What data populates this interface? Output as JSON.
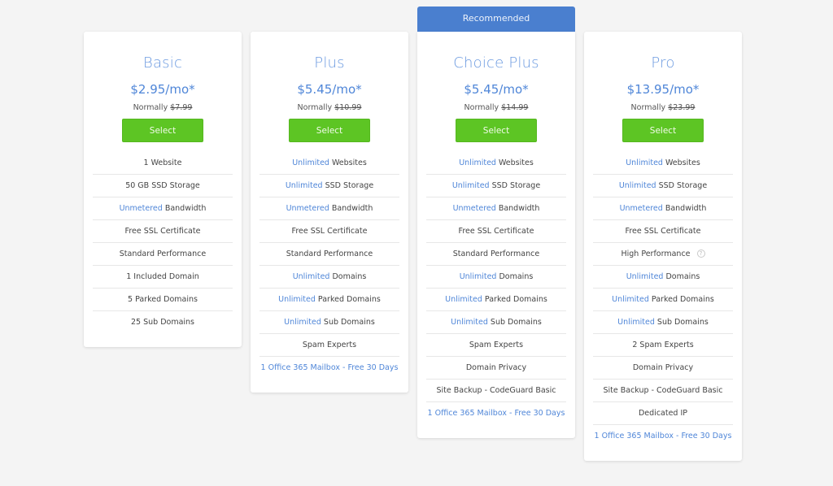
{
  "recommended_label": "Recommended",
  "plans": [
    {
      "name": "Basic",
      "price": "$2.95/mo*",
      "normally_label": "Normally",
      "normal_price": "$7.99",
      "select_label": "Select",
      "features": [
        {
          "highlight": "",
          "text": "1 Website"
        },
        {
          "highlight": "",
          "text": "50 GB SSD Storage"
        },
        {
          "highlight": "Unmetered",
          "text": " Bandwidth"
        },
        {
          "highlight": "",
          "text": "Free SSL Certificate"
        },
        {
          "highlight": "",
          "text": "Standard Performance"
        },
        {
          "highlight": "",
          "text": "1 Included Domain"
        },
        {
          "highlight": "",
          "text": "5 Parked Domains"
        },
        {
          "highlight": "",
          "text": "25 Sub Domains"
        }
      ]
    },
    {
      "name": "Plus",
      "price": "$5.45/mo*",
      "normally_label": "Normally",
      "normal_price": "$10.99",
      "select_label": "Select",
      "features": [
        {
          "highlight": "Unlimited",
          "text": " Websites"
        },
        {
          "highlight": "Unlimited",
          "text": " SSD Storage"
        },
        {
          "highlight": "Unmetered",
          "text": " Bandwidth"
        },
        {
          "highlight": "",
          "text": "Free SSL Certificate"
        },
        {
          "highlight": "",
          "text": "Standard Performance"
        },
        {
          "highlight": "Unlimited",
          "text": " Domains"
        },
        {
          "highlight": "Unlimited",
          "text": " Parked Domains"
        },
        {
          "highlight": "Unlimited",
          "text": " Sub Domains"
        },
        {
          "highlight": "",
          "text": "Spam Experts"
        },
        {
          "highlight": "",
          "text": "",
          "link": "1 Office 365 Mailbox - Free 30 Days"
        }
      ]
    },
    {
      "name": "Choice Plus",
      "price": "$5.45/mo*",
      "normally_label": "Normally",
      "normal_price": "$14.99",
      "select_label": "Select",
      "features": [
        {
          "highlight": "Unlimited",
          "text": " Websites"
        },
        {
          "highlight": "Unlimited",
          "text": " SSD Storage"
        },
        {
          "highlight": "Unmetered",
          "text": " Bandwidth"
        },
        {
          "highlight": "",
          "text": "Free SSL Certificate"
        },
        {
          "highlight": "",
          "text": "Standard Performance"
        },
        {
          "highlight": "Unlimited",
          "text": " Domains"
        },
        {
          "highlight": "Unlimited",
          "text": " Parked Domains"
        },
        {
          "highlight": "Unlimited",
          "text": " Sub Domains"
        },
        {
          "highlight": "",
          "text": "Spam Experts"
        },
        {
          "highlight": "",
          "text": "Domain Privacy"
        },
        {
          "highlight": "",
          "text": "Site Backup - CodeGuard Basic"
        },
        {
          "highlight": "",
          "text": "",
          "link": "1 Office 365 Mailbox - Free 30 Days"
        }
      ]
    },
    {
      "name": "Pro",
      "price": "$13.95/mo*",
      "normally_label": "Normally",
      "normal_price": "$23.99",
      "select_label": "Select",
      "features": [
        {
          "highlight": "Unlimited",
          "text": " Websites"
        },
        {
          "highlight": "Unlimited",
          "text": " SSD Storage"
        },
        {
          "highlight": "Unmetered",
          "text": " Bandwidth"
        },
        {
          "highlight": "",
          "text": "Free SSL Certificate"
        },
        {
          "highlight": "",
          "text": "High Performance",
          "help_icon": "?"
        },
        {
          "highlight": "Unlimited",
          "text": " Domains"
        },
        {
          "highlight": "Unlimited",
          "text": " Parked Domains"
        },
        {
          "highlight": "Unlimited",
          "text": " Sub Domains"
        },
        {
          "highlight": "",
          "text": "2 Spam Experts"
        },
        {
          "highlight": "",
          "text": "Domain Privacy"
        },
        {
          "highlight": "",
          "text": "Site Backup - CodeGuard Basic"
        },
        {
          "highlight": "",
          "text": "Dedicated IP"
        },
        {
          "highlight": "",
          "text": "",
          "link": "1 Office 365 Mailbox - Free 30 Days"
        }
      ]
    }
  ]
}
